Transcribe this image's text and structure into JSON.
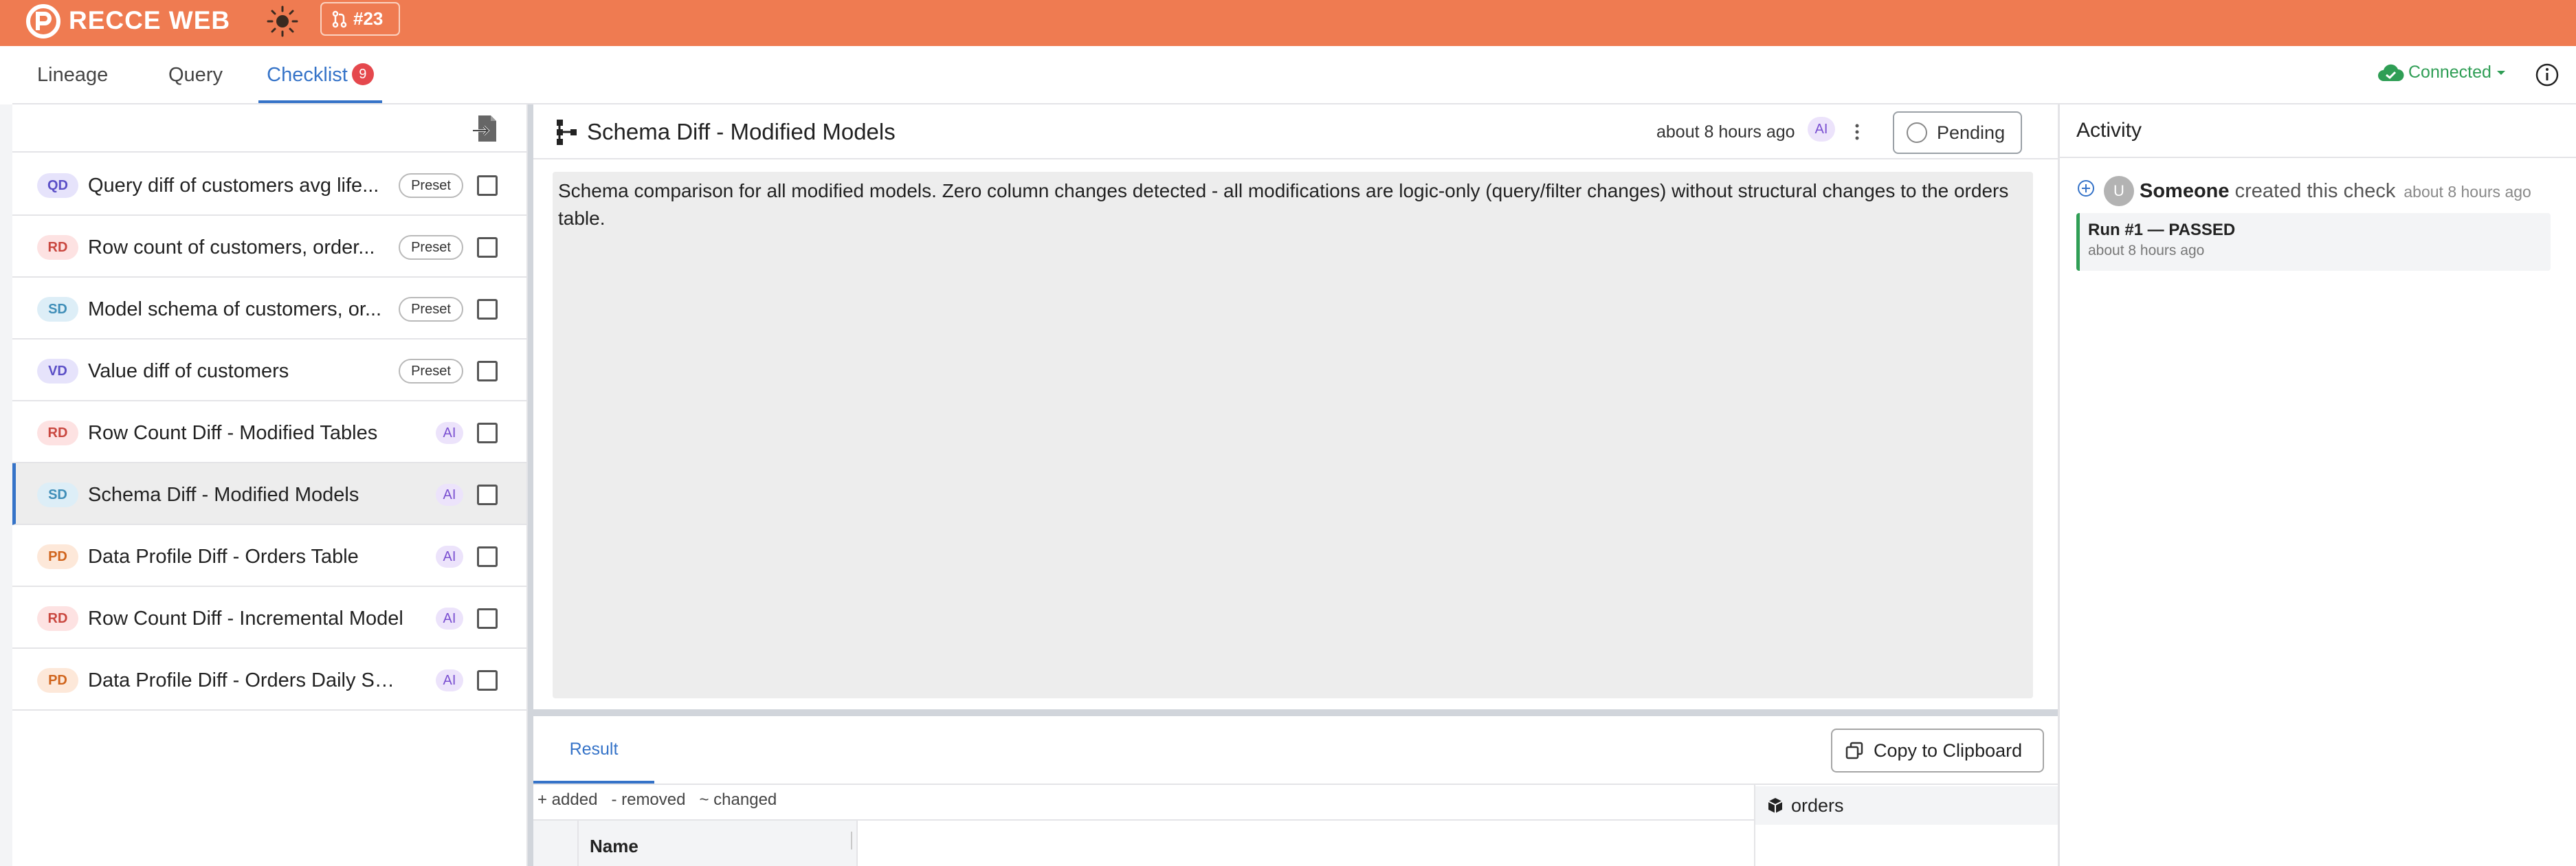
{
  "header": {
    "brand": "RECCE WEB",
    "pr_number": "#23",
    "colors": {
      "brand_bar": "#ef7b51",
      "accent": "#3573c8",
      "success": "#2f9e55",
      "danger": "#e5484d"
    }
  },
  "nav": {
    "tabs": [
      {
        "label": "Lineage"
      },
      {
        "label": "Query"
      },
      {
        "label": "Checklist",
        "count": "9"
      }
    ],
    "active_tab": "Checklist",
    "connection_status": "Connected"
  },
  "checklist": {
    "items": [
      {
        "type": "QD",
        "name": "Query diff of customers avg life...",
        "tag": "Preset",
        "checked": false
      },
      {
        "type": "RD",
        "name": "Row count of customers, order...",
        "tag": "Preset",
        "checked": false
      },
      {
        "type": "SD",
        "name": "Model schema of customers, or...",
        "tag": "Preset",
        "checked": false
      },
      {
        "type": "VD",
        "name": "Value diff of customers",
        "tag": "Preset",
        "checked": false
      },
      {
        "type": "RD",
        "name": "Row Count Diff - Modified Tables",
        "tag": "AI",
        "checked": false
      },
      {
        "type": "SD",
        "name": "Schema Diff - Modified Models",
        "tag": "AI",
        "checked": false,
        "selected": true
      },
      {
        "type": "PD",
        "name": "Data Profile Diff - Orders Table",
        "tag": "AI",
        "checked": false
      },
      {
        "type": "RD",
        "name": "Row Count Diff - Incremental Model",
        "tag": "AI",
        "checked": false
      },
      {
        "type": "PD",
        "name": "Data Profile Diff - Orders Daily Sum...",
        "tag": "AI",
        "checked": false
      }
    ]
  },
  "check": {
    "title": "Schema Diff - Modified Models",
    "updated": "about 8 hours ago",
    "ai_badge": "AI",
    "status_button": "Pending",
    "description": "Schema comparison for all modified models. Zero column changes detected - all modifications are logic-only (query/filter changes) without structural changes to the orders table."
  },
  "result": {
    "tab_label": "Result",
    "copy_button": "Copy to Clipboard",
    "legend": {
      "added": "+ added",
      "removed": "- removed",
      "changed": "~ changed"
    },
    "column_header": "Name",
    "model_name": "orders"
  },
  "activity": {
    "title": "Activity",
    "avatar_letter": "U",
    "user": "Someone",
    "action": "created this check",
    "time": "about 8 hours ago",
    "run": {
      "title": "Run #1 — PASSED",
      "time": "about 8 hours ago"
    }
  }
}
